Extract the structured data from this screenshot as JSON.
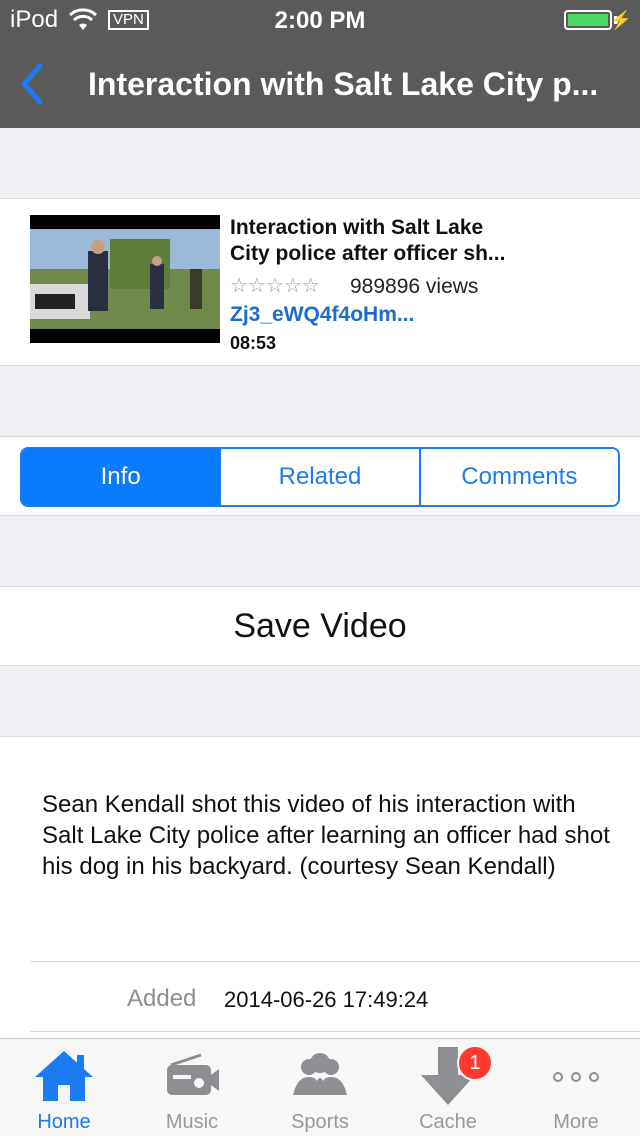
{
  "status_bar": {
    "carrier": "iPod",
    "vpn": "VPN",
    "time": "2:00 PM"
  },
  "nav": {
    "title": "Interaction with Salt Lake City p..."
  },
  "video": {
    "title_line1": "Interaction with Salt Lake",
    "title_line2": "City police after officer sh...",
    "rating_stars": "☆☆☆☆☆",
    "views": "989896 views",
    "video_id": "Zj3_eWQ4f4oHm...",
    "duration": "08:53"
  },
  "segments": [
    {
      "label": "Info",
      "active": true
    },
    {
      "label": "Related",
      "active": false
    },
    {
      "label": "Comments",
      "active": false
    }
  ],
  "save_label": "Save Video",
  "description": {
    "text": "Sean Kendall shot this video of his interaction with Salt Lake City police after learning an officer had shot his dog in his backyard. (courtesy Sean Kendall)",
    "added_label": "Added",
    "added_value": "2014-06-26 17:49:24"
  },
  "tabs": [
    {
      "label": "Home",
      "icon": "home-icon",
      "active": true
    },
    {
      "label": "Music",
      "icon": "music-radio-icon",
      "active": false
    },
    {
      "label": "Sports",
      "icon": "people-icon",
      "active": false
    },
    {
      "label": "Cache",
      "icon": "download-arrow-icon",
      "active": false,
      "badge": "1"
    },
    {
      "label": "More",
      "icon": "more-dots-icon",
      "active": false
    }
  ],
  "colors": {
    "accent": "#0a7bff",
    "bar": "#5a5a5a",
    "battery": "#4cd964",
    "badge": "#ff3b30"
  }
}
